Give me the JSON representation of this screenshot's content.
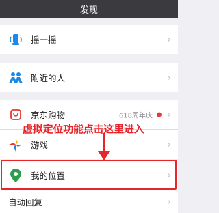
{
  "header": {
    "title": "发现"
  },
  "items": {
    "shake": {
      "label": "摇一摇",
      "icon": "shake-icon"
    },
    "nearby": {
      "label": "附近的人",
      "icon": "people-nearby-icon"
    },
    "jd": {
      "label": "京东购物",
      "badge_text": "618周年庆",
      "icon": "jd-shopping-icon"
    },
    "games": {
      "label": "游戏",
      "icon": "games-icon"
    },
    "location": {
      "label": "我的位置",
      "icon": "location-pin-icon"
    },
    "auto_reply": {
      "label": "自动回复"
    }
  },
  "annotation": {
    "text": "虚拟定位功能点击这里进入",
    "color": "#e8252b"
  },
  "colors": {
    "navbar_bg": "#3b3b3f",
    "page_bg": "#efeff4",
    "highlight": "#e8252b",
    "icon_blue": "#1e88e5",
    "icon_green": "#2e9d4f",
    "jd_red": "#e53935"
  }
}
